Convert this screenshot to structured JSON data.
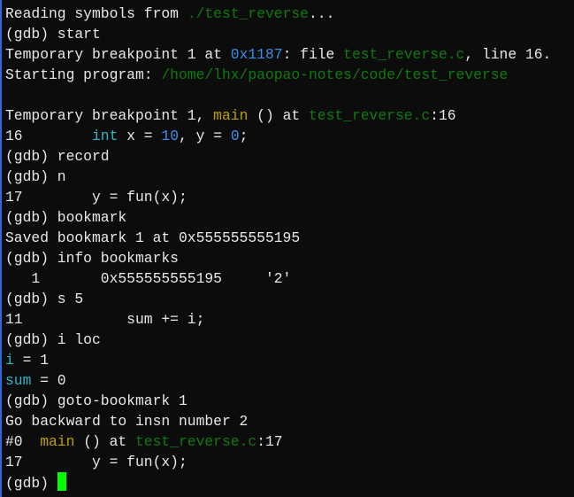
{
  "colors": {
    "path": "#0f7a0f",
    "address": "#3b8eea",
    "function": "#c1a000",
    "variable": "#2fb5c8",
    "cursor": "#00ff00",
    "background": "#0c0c0c"
  },
  "lines": [
    [
      {
        "t": "Reading symbols from "
      },
      {
        "t": "./test_reverse",
        "c": "green"
      },
      {
        "t": "..."
      }
    ],
    [
      {
        "t": "(gdb) start"
      }
    ],
    [
      {
        "t": "Temporary breakpoint 1 at "
      },
      {
        "t": "0x1187",
        "c": "blue"
      },
      {
        "t": ": file "
      },
      {
        "t": "test_reverse.c",
        "c": "green"
      },
      {
        "t": ", line 16."
      }
    ],
    [
      {
        "t": "Starting program: "
      },
      {
        "t": "/home/lhx/paopao-notes/code/test_reverse",
        "c": "green"
      }
    ],
    [
      {
        "t": ""
      }
    ],
    [
      {
        "t": "Temporary breakpoint 1, "
      },
      {
        "t": "main",
        "c": "yellow"
      },
      {
        "t": " () at "
      },
      {
        "t": "test_reverse.c",
        "c": "green"
      },
      {
        "t": ":16"
      }
    ],
    [
      {
        "t": "16        "
      },
      {
        "t": "int",
        "c": "cyan"
      },
      {
        "t": " x = "
      },
      {
        "t": "10",
        "c": "blue"
      },
      {
        "t": ", y = "
      },
      {
        "t": "0",
        "c": "blue"
      },
      {
        "t": ";"
      }
    ],
    [
      {
        "t": "(gdb) record"
      }
    ],
    [
      {
        "t": "(gdb) n"
      }
    ],
    [
      {
        "t": "17        y = fun(x);"
      }
    ],
    [
      {
        "t": "(gdb) bookmark"
      }
    ],
    [
      {
        "t": "Saved bookmark 1 at 0x555555555195"
      }
    ],
    [
      {
        "t": "(gdb) info bookmarks"
      }
    ],
    [
      {
        "t": "   1       0x555555555195     '2'"
      }
    ],
    [
      {
        "t": "(gdb) s 5"
      }
    ],
    [
      {
        "t": "11            sum += i;"
      }
    ],
    [
      {
        "t": "(gdb) i loc"
      }
    ],
    [
      {
        "t": "i",
        "c": "cyan"
      },
      {
        "t": " = 1"
      }
    ],
    [
      {
        "t": "sum",
        "c": "cyan"
      },
      {
        "t": " = 0"
      }
    ],
    [
      {
        "t": "(gdb) goto-bookmark 1"
      }
    ],
    [
      {
        "t": "Go backward to insn number 2"
      }
    ],
    [
      {
        "t": "#0  "
      },
      {
        "t": "main",
        "c": "yellow"
      },
      {
        "t": " () at "
      },
      {
        "t": "test_reverse.c",
        "c": "green"
      },
      {
        "t": ":17"
      }
    ],
    [
      {
        "t": "17        y = fun(x);"
      }
    ],
    [
      {
        "t": "(gdb) "
      }
    ]
  ]
}
